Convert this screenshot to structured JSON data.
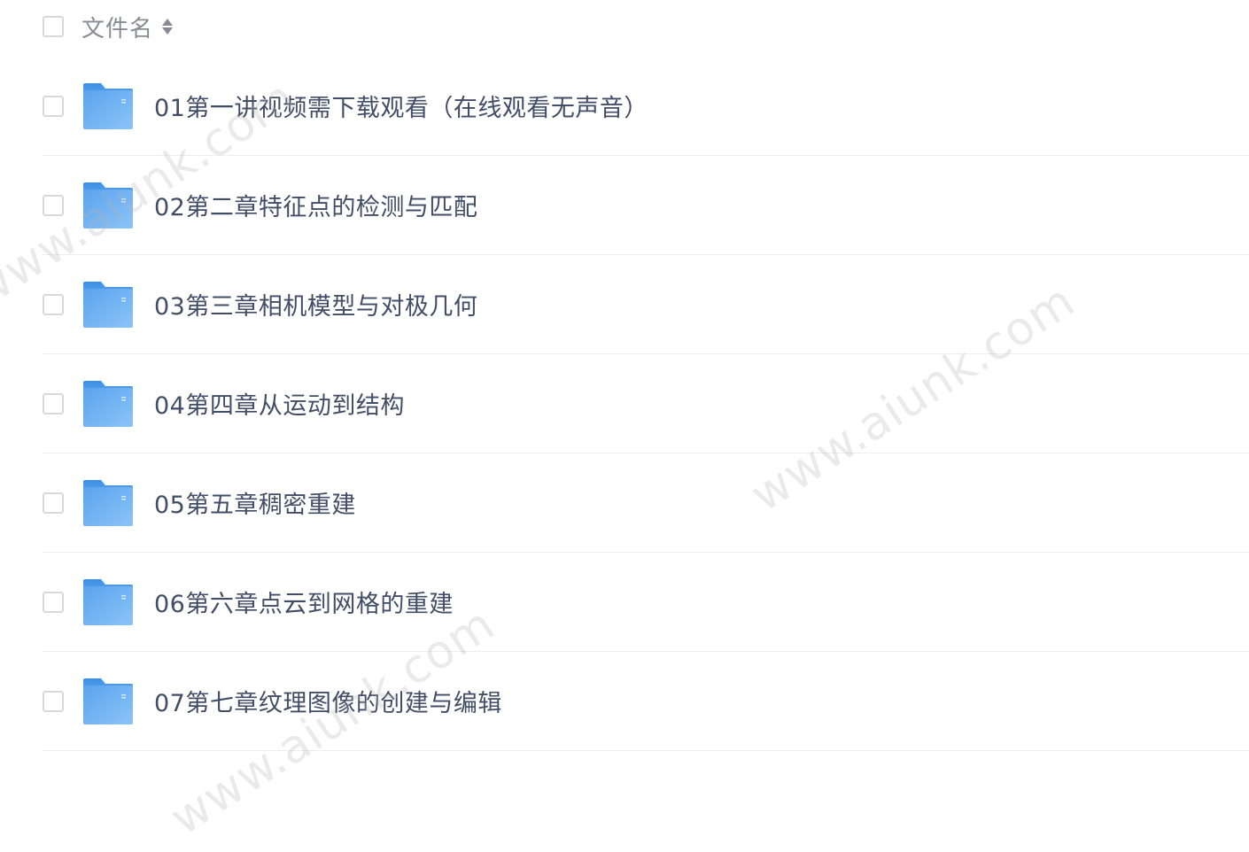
{
  "header": {
    "column_label": "文件名",
    "sort_icon": "sort-icon"
  },
  "files": [
    {
      "name": "01第一讲视频需下载观看（在线观看无声音）",
      "icon": "folder-icon"
    },
    {
      "name": "02第二章特征点的检测与匹配",
      "icon": "folder-icon"
    },
    {
      "name": "03第三章相机模型与对极几何",
      "icon": "folder-icon"
    },
    {
      "name": "04第四章从运动到结构",
      "icon": "folder-icon"
    },
    {
      "name": "05第五章稠密重建",
      "icon": "folder-icon"
    },
    {
      "name": "06第六章点云到网格的重建",
      "icon": "folder-icon"
    },
    {
      "name": "07第七章纹理图像的创建与编辑",
      "icon": "folder-icon"
    }
  ],
  "watermarks": [
    "www.aiunk.com",
    "www.aiunk.com",
    "www.aiunk.com"
  ],
  "colors": {
    "folder": "#6aaef0",
    "text": "#424e67",
    "header_text": "#878c94"
  }
}
